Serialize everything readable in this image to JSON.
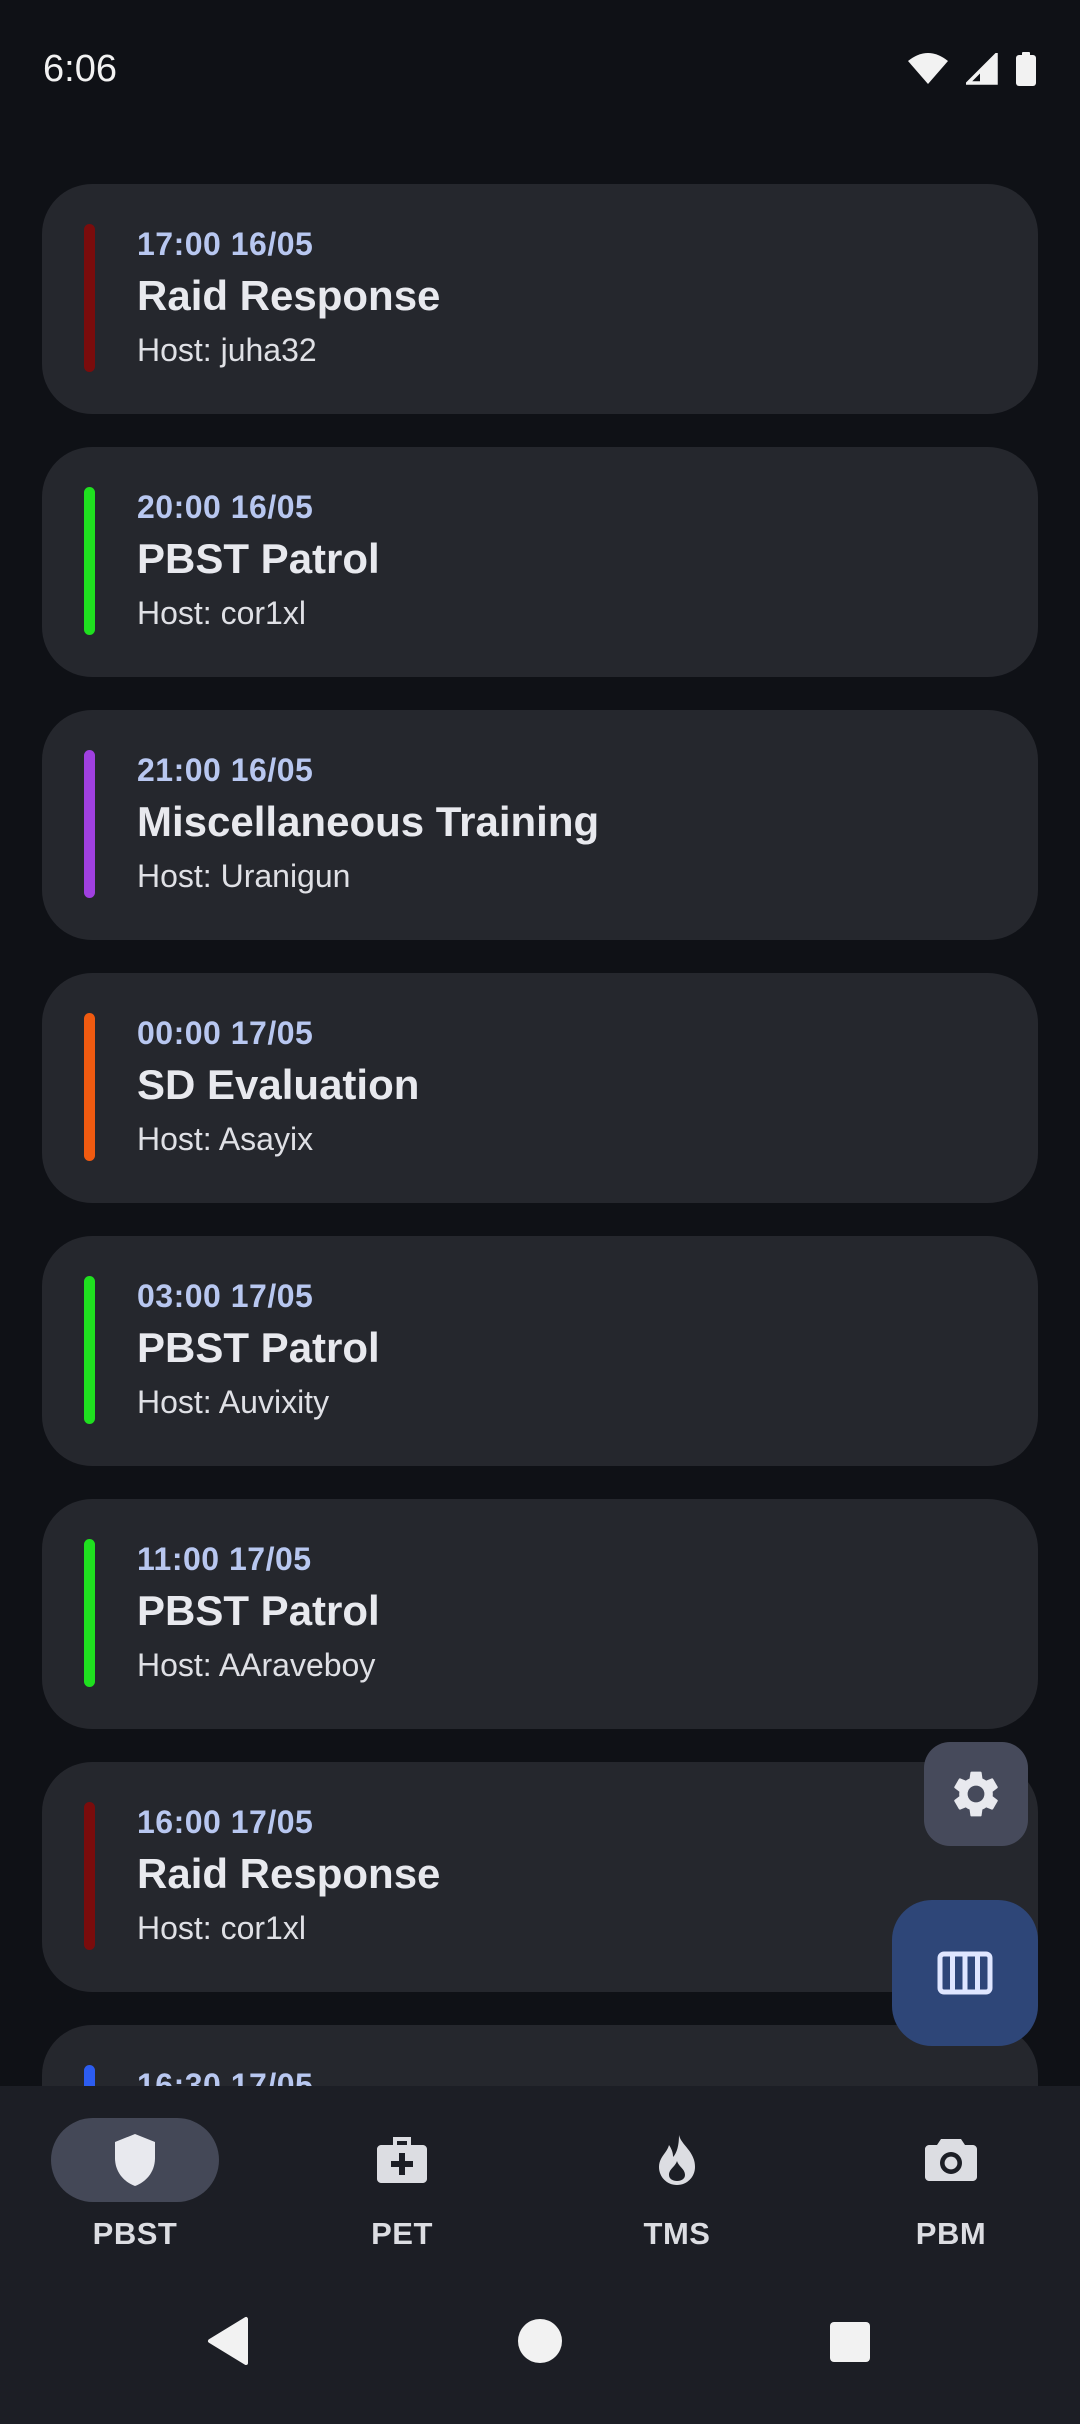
{
  "status": {
    "time": "6:06"
  },
  "events": [
    {
      "time": "17:00 16/05",
      "title": "Raid Response",
      "host": "Host: juha32",
      "color": "#7a0c0c"
    },
    {
      "time": "20:00 16/05",
      "title": "PBST Patrol",
      "host": "Host: cor1xl",
      "color": "#1fe01f"
    },
    {
      "time": "21:00 16/05",
      "title": "Miscellaneous Training",
      "host": "Host: Uranigun",
      "color": "#a040e0"
    },
    {
      "time": "00:00 17/05",
      "title": "SD Evaluation",
      "host": "Host: Asayix",
      "color": "#f05a10"
    },
    {
      "time": "03:00 17/05",
      "title": "PBST Patrol",
      "host": "Host: Auvixity",
      "color": "#1fe01f"
    },
    {
      "time": "11:00 17/05",
      "title": "PBST Patrol",
      "host": "Host: AAraveboy",
      "color": "#1fe01f"
    },
    {
      "time": "16:00 17/05",
      "title": "Raid Response",
      "host": "Host: cor1xl",
      "color": "#7a0c0c"
    },
    {
      "time": "16:30 17/05",
      "title": "",
      "host": "",
      "color": "#2c5cf0"
    }
  ],
  "fabs": {
    "settings_icon": "gear-icon",
    "main_icon": "view-week-icon"
  },
  "nav": {
    "items": [
      {
        "label": "PBST",
        "icon": "shield-icon",
        "active": true
      },
      {
        "label": "PET",
        "icon": "medical-kit-icon",
        "active": false
      },
      {
        "label": "TMS",
        "icon": "flame-icon",
        "active": false
      },
      {
        "label": "PBM",
        "icon": "camera-icon",
        "active": false
      }
    ]
  },
  "system_nav": {
    "back": "back-icon",
    "home": "home-icon",
    "recents": "recents-icon"
  }
}
